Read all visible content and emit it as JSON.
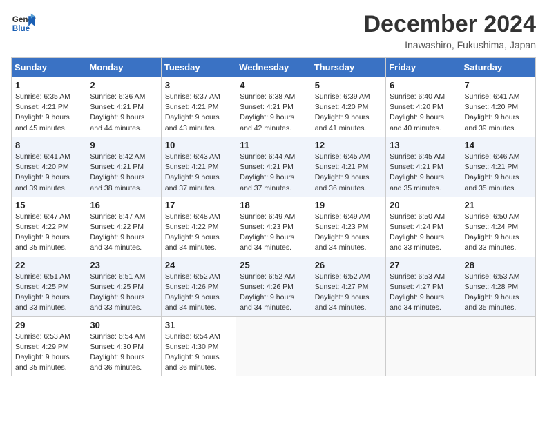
{
  "logo": {
    "line1": "General",
    "line2": "Blue"
  },
  "title": "December 2024",
  "subtitle": "Inawashiro, Fukushima, Japan",
  "header": {
    "days": [
      "Sunday",
      "Monday",
      "Tuesday",
      "Wednesday",
      "Thursday",
      "Friday",
      "Saturday"
    ]
  },
  "weeks": [
    [
      {
        "day": "1",
        "sunrise": "6:35 AM",
        "sunset": "4:21 PM",
        "daylight": "9 hours and 45 minutes."
      },
      {
        "day": "2",
        "sunrise": "6:36 AM",
        "sunset": "4:21 PM",
        "daylight": "9 hours and 44 minutes."
      },
      {
        "day": "3",
        "sunrise": "6:37 AM",
        "sunset": "4:21 PM",
        "daylight": "9 hours and 43 minutes."
      },
      {
        "day": "4",
        "sunrise": "6:38 AM",
        "sunset": "4:21 PM",
        "daylight": "9 hours and 42 minutes."
      },
      {
        "day": "5",
        "sunrise": "6:39 AM",
        "sunset": "4:20 PM",
        "daylight": "9 hours and 41 minutes."
      },
      {
        "day": "6",
        "sunrise": "6:40 AM",
        "sunset": "4:20 PM",
        "daylight": "9 hours and 40 minutes."
      },
      {
        "day": "7",
        "sunrise": "6:41 AM",
        "sunset": "4:20 PM",
        "daylight": "9 hours and 39 minutes."
      }
    ],
    [
      {
        "day": "8",
        "sunrise": "6:41 AM",
        "sunset": "4:20 PM",
        "daylight": "9 hours and 39 minutes."
      },
      {
        "day": "9",
        "sunrise": "6:42 AM",
        "sunset": "4:21 PM",
        "daylight": "9 hours and 38 minutes."
      },
      {
        "day": "10",
        "sunrise": "6:43 AM",
        "sunset": "4:21 PM",
        "daylight": "9 hours and 37 minutes."
      },
      {
        "day": "11",
        "sunrise": "6:44 AM",
        "sunset": "4:21 PM",
        "daylight": "9 hours and 37 minutes."
      },
      {
        "day": "12",
        "sunrise": "6:45 AM",
        "sunset": "4:21 PM",
        "daylight": "9 hours and 36 minutes."
      },
      {
        "day": "13",
        "sunrise": "6:45 AM",
        "sunset": "4:21 PM",
        "daylight": "9 hours and 35 minutes."
      },
      {
        "day": "14",
        "sunrise": "6:46 AM",
        "sunset": "4:21 PM",
        "daylight": "9 hours and 35 minutes."
      }
    ],
    [
      {
        "day": "15",
        "sunrise": "6:47 AM",
        "sunset": "4:22 PM",
        "daylight": "9 hours and 35 minutes."
      },
      {
        "day": "16",
        "sunrise": "6:47 AM",
        "sunset": "4:22 PM",
        "daylight": "9 hours and 34 minutes."
      },
      {
        "day": "17",
        "sunrise": "6:48 AM",
        "sunset": "4:22 PM",
        "daylight": "9 hours and 34 minutes."
      },
      {
        "day": "18",
        "sunrise": "6:49 AM",
        "sunset": "4:23 PM",
        "daylight": "9 hours and 34 minutes."
      },
      {
        "day": "19",
        "sunrise": "6:49 AM",
        "sunset": "4:23 PM",
        "daylight": "9 hours and 34 minutes."
      },
      {
        "day": "20",
        "sunrise": "6:50 AM",
        "sunset": "4:24 PM",
        "daylight": "9 hours and 33 minutes."
      },
      {
        "day": "21",
        "sunrise": "6:50 AM",
        "sunset": "4:24 PM",
        "daylight": "9 hours and 33 minutes."
      }
    ],
    [
      {
        "day": "22",
        "sunrise": "6:51 AM",
        "sunset": "4:25 PM",
        "daylight": "9 hours and 33 minutes."
      },
      {
        "day": "23",
        "sunrise": "6:51 AM",
        "sunset": "4:25 PM",
        "daylight": "9 hours and 33 minutes."
      },
      {
        "day": "24",
        "sunrise": "6:52 AM",
        "sunset": "4:26 PM",
        "daylight": "9 hours and 34 minutes."
      },
      {
        "day": "25",
        "sunrise": "6:52 AM",
        "sunset": "4:26 PM",
        "daylight": "9 hours and 34 minutes."
      },
      {
        "day": "26",
        "sunrise": "6:52 AM",
        "sunset": "4:27 PM",
        "daylight": "9 hours and 34 minutes."
      },
      {
        "day": "27",
        "sunrise": "6:53 AM",
        "sunset": "4:27 PM",
        "daylight": "9 hours and 34 minutes."
      },
      {
        "day": "28",
        "sunrise": "6:53 AM",
        "sunset": "4:28 PM",
        "daylight": "9 hours and 35 minutes."
      }
    ],
    [
      {
        "day": "29",
        "sunrise": "6:53 AM",
        "sunset": "4:29 PM",
        "daylight": "9 hours and 35 minutes."
      },
      {
        "day": "30",
        "sunrise": "6:54 AM",
        "sunset": "4:30 PM",
        "daylight": "9 hours and 36 minutes."
      },
      {
        "day": "31",
        "sunrise": "6:54 AM",
        "sunset": "4:30 PM",
        "daylight": "9 hours and 36 minutes."
      },
      null,
      null,
      null,
      null
    ]
  ]
}
